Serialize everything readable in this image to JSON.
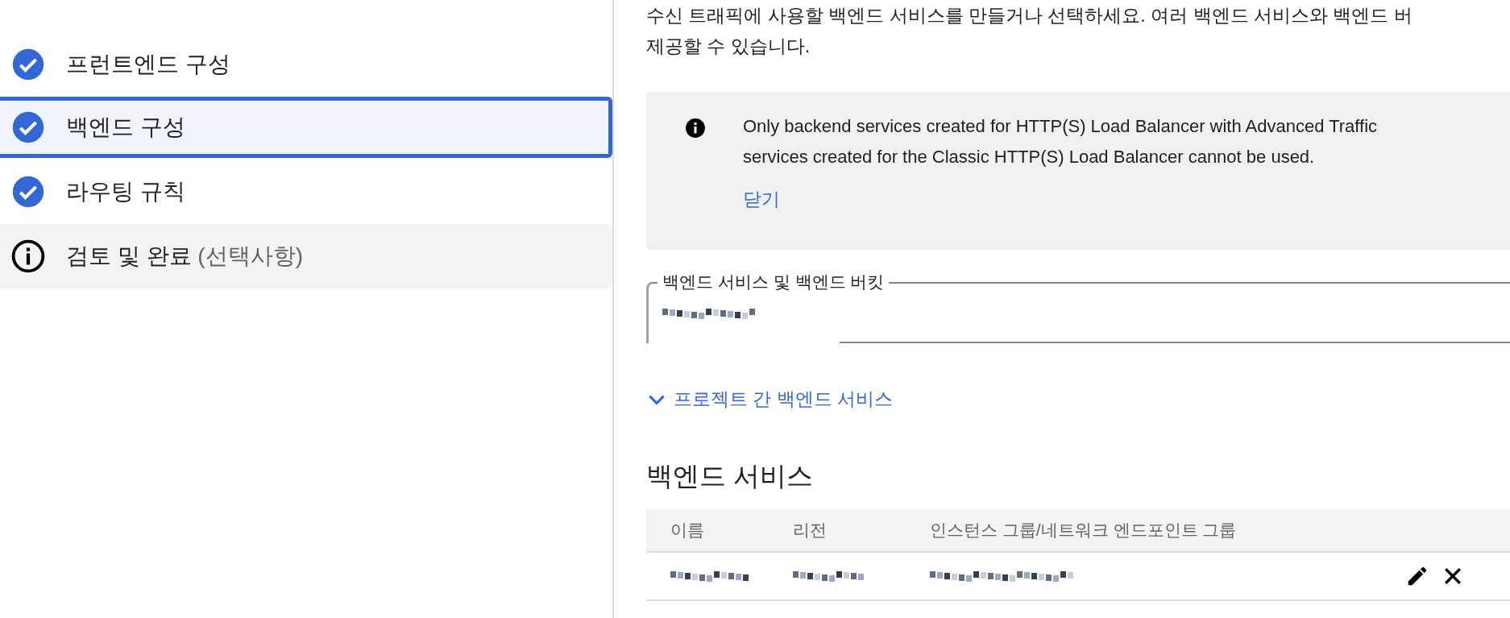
{
  "steps": [
    {
      "label": "프런트엔드 구성",
      "kind": "done",
      "selected": false
    },
    {
      "label": "백엔드 구성",
      "kind": "done",
      "selected": true
    },
    {
      "label": "라우팅 규칙",
      "kind": "done",
      "selected": false
    },
    {
      "label": "검토 및 완료",
      "note": "(선택사항)",
      "kind": "info",
      "selected": false
    }
  ],
  "intro": [
    "수신 트래픽에 사용할 백엔드 서비스를 만들거나 선택하세요. 여러 백엔드 서비스와 백엔드 버",
    "제공할 수 있습니다."
  ],
  "notice": {
    "lines": [
      "Only backend services created for HTTP(S) Load Balancer with Advanced Traffic",
      "services created for the Classic HTTP(S) Load Balancer cannot be used."
    ],
    "dismiss": "닫기"
  },
  "backend_field": {
    "label": "백엔드 서비스 및 백엔드 버킷"
  },
  "cross_project": {
    "label": "프로젝트 간 백엔드 서비스",
    "expanded": false
  },
  "section_title": "백엔드 서비스",
  "table": {
    "columns": [
      "이름",
      "리전",
      "인스턴스 그룹/네트워크 엔드포인트 그룹"
    ],
    "rows": [
      {
        "cells": [
          {
            "kind": "redacted"
          },
          {
            "kind": "redacted"
          },
          {
            "kind": "redacted"
          }
        ]
      }
    ]
  }
}
